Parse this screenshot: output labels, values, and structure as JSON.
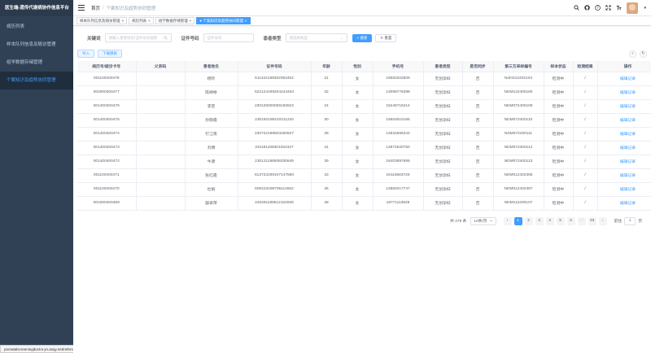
{
  "app_title": "医生端-遗传代谢病协作信息平台",
  "sidebar": {
    "items": [
      {
        "label": "病历列表"
      },
      {
        "label": "样本队列信息及随访管理"
      },
      {
        "label": "组学数据存储管理"
      },
      {
        "label": "个案知识及趋势协同管理"
      }
    ],
    "active_index": 3
  },
  "status_url": "prenatalscreeningdoctor.yn.asqy.net/referralRecord",
  "navbar": {
    "breadcrumb_home": "首页",
    "breadcrumb_sep": "/",
    "breadcrumb_current": "个案知识及趋势协同管理"
  },
  "tags": [
    {
      "label": "样本队列信息及随访管理",
      "close": "×"
    },
    {
      "label": "病历列表",
      "close": "×"
    },
    {
      "label": "组学数据存储管理",
      "close": "×"
    },
    {
      "label": "个案知识及趋势协同管理",
      "close": "×",
      "dot": "●"
    }
  ],
  "search": {
    "keyword_label": "关键词",
    "keyword_placeholder": "请输入患者姓名/证件号码搜索",
    "idno_label": "证件号码",
    "idno_placeholder": "证件号码",
    "type_label": "患者类型",
    "type_placeholder": "请选择类型",
    "search_button": "搜索",
    "reset_button": "重置"
  },
  "toolbar": {
    "import_button": "导入",
    "download_button": "下载模板"
  },
  "table": {
    "columns": [
      "病历号/就诊卡号",
      "父亲码",
      "患者姓名",
      "证件号码",
      "年龄",
      "性别",
      "手机号",
      "患者类型",
      "是否同步",
      "第三方采样编号",
      "样本状态",
      "检测结果",
      "操作"
    ],
    "rows": [
      [
        "001100400478",
        "",
        "杨玲",
        "511324199302063402",
        "31",
        "女",
        "18582202609",
        "无创孕妇",
        "否",
        "Ndm012402104",
        "检测中",
        "/",
        "编辑记录"
      ],
      [
        "002000400477",
        "",
        "陈婷婷",
        "522124199204244463",
        "32",
        "女",
        "13098778398",
        "无创孕妇",
        "否",
        "NDM122400160",
        "检测中",
        "/",
        "编辑记录"
      ],
      [
        "001400400476",
        "",
        "李芸",
        "230128200008150822",
        "24",
        "女",
        "15246716214",
        "无创孕妇",
        "否",
        "NDM072400109",
        "检测中",
        "/",
        "编辑记录"
      ],
      [
        "001400400475",
        "",
        "孙晓霞",
        "230182199310311220",
        "30",
        "女",
        "15604610166",
        "无创孕妇",
        "否",
        "NDM072400110",
        "检测中",
        "/",
        "编辑记录"
      ],
      [
        "001400400474",
        "",
        "钉江南",
        "230722198503260927",
        "39",
        "女",
        "13634586344",
        "无创孕妇",
        "否",
        "NDM072400111",
        "检测中",
        "/",
        "编辑记录"
      ],
      [
        "001400400473",
        "",
        "刘博",
        "231181198301052327",
        "41",
        "女",
        "13674520750",
        "无创孕妇",
        "否",
        "NDM072400112",
        "检测中",
        "/",
        "编辑记录"
      ],
      [
        "001400400472",
        "",
        "牛源",
        "230121198506030649",
        "39",
        "女",
        "18403897666",
        "无创孕妇",
        "否",
        "NDM072400113",
        "检测中",
        "/",
        "编辑记录"
      ],
      [
        "001100400471",
        "",
        "张红霞",
        "513723199107147560",
        "33",
        "女",
        "18116583726",
        "无创孕妇",
        "否",
        "NDM012402395",
        "检测中",
        "/",
        "编辑记录"
      ],
      [
        "001100400470",
        "",
        "杜娟",
        "500223198706114502",
        "36",
        "女",
        "13882017747",
        "无创孕妇",
        "否",
        "NDM012402397",
        "检测中",
        "/",
        "编辑记录"
      ],
      [
        "001000400469",
        "",
        "殷翠萍",
        "420281198612102846",
        "38",
        "女",
        "18771113828",
        "无创孕妇",
        "否",
        "NDM112400107",
        "检测中",
        "/",
        "编辑记录"
      ]
    ]
  },
  "pagination": {
    "total": "共 479 条",
    "page_size": "10条/页",
    "prev": "‹",
    "pages": [
      "1",
      "2",
      "3",
      "4",
      "5",
      "6",
      "···",
      "48"
    ],
    "active_page": "1",
    "next": "›",
    "goto_label": "前往",
    "goto_value": "1",
    "goto_suffix": "页"
  },
  "icons": {
    "search": "search-icon",
    "github": "github-icon",
    "help": "question-icon",
    "fullscreen": "fullscreen-icon",
    "fontsize": "font-size-icon",
    "refresh": "refresh-icon"
  },
  "colors": {
    "sidebar_bg": "#304156",
    "sidebar_active_text": "#409eff",
    "primary": "#409eff"
  }
}
